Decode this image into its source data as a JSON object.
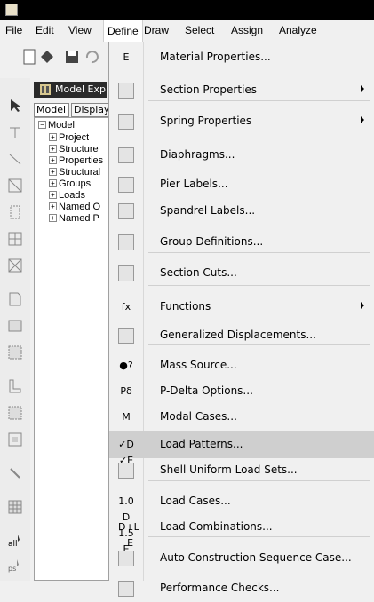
{
  "menubar": {
    "items": [
      "File",
      "Edit",
      "View",
      "Define",
      "Draw",
      "Select",
      "Assign",
      "Analyze"
    ]
  },
  "explorer": {
    "title": "Model Exp",
    "tabs": [
      "Model",
      "Display"
    ],
    "tree": {
      "root": "Model",
      "children": [
        "Project",
        "Structure",
        "Properties",
        "Structural",
        "Groups",
        "Loads",
        "Named O",
        "Named P"
      ]
    }
  },
  "define_menu": {
    "items": [
      {
        "icon": "material-properties-icon",
        "label": "Material Properties...",
        "submenu": false
      },
      {
        "icon": "section-properties-icon",
        "label": "Section Properties",
        "submenu": true
      },
      {
        "icon": "spring-properties-icon",
        "label": "Spring Properties",
        "submenu": true
      },
      {
        "icon": "diaphragms-icon",
        "label": "Diaphragms...",
        "submenu": false
      },
      {
        "icon": "pier-labels-icon",
        "label": "Pier Labels...",
        "submenu": false
      },
      {
        "icon": "spandrel-labels-icon",
        "label": "Spandrel Labels...",
        "submenu": false
      },
      {
        "icon": "group-definitions-icon",
        "label": "Group Definitions...",
        "submenu": false
      },
      {
        "icon": "section-cuts-icon",
        "label": "Section Cuts...",
        "submenu": false
      },
      {
        "icon": "functions-icon",
        "label": "Functions",
        "submenu": true
      },
      {
        "icon": "generalized-displacements-icon",
        "label": "Generalized Displacements...",
        "submenu": false
      },
      {
        "icon": "mass-source-icon",
        "label": "Mass Source...",
        "submenu": false
      },
      {
        "icon": "p-delta-icon",
        "label": "P-Delta Options...",
        "submenu": false
      },
      {
        "icon": "modal-cases-icon",
        "label": "Modal Cases...",
        "submenu": false
      },
      {
        "icon": "load-patterns-icon",
        "label": "Load Patterns...",
        "submenu": false,
        "highlighted": true
      },
      {
        "icon": "shell-uniform-load-sets-icon",
        "label": "Shell Uniform Load Sets...",
        "submenu": false
      },
      {
        "icon": "load-cases-icon",
        "label": "Load Cases...",
        "submenu": false
      },
      {
        "icon": "load-combinations-icon",
        "label": "Load Combinations...",
        "submenu": false
      },
      {
        "icon": "auto-construction-sequence-icon",
        "label": "Auto Construction Sequence Case...",
        "submenu": false
      },
      {
        "icon": "performance-checks-icon",
        "label": "Performance Checks...",
        "submenu": false
      }
    ],
    "icon_glyphs": [
      "E",
      "",
      "",
      "",
      "",
      "",
      "",
      "",
      "fx",
      "",
      "●?",
      "Pδ",
      "M",
      "✓D ✓E",
      "",
      "1.0 D 1.5 E",
      "D+L +E",
      "",
      ""
    ]
  }
}
